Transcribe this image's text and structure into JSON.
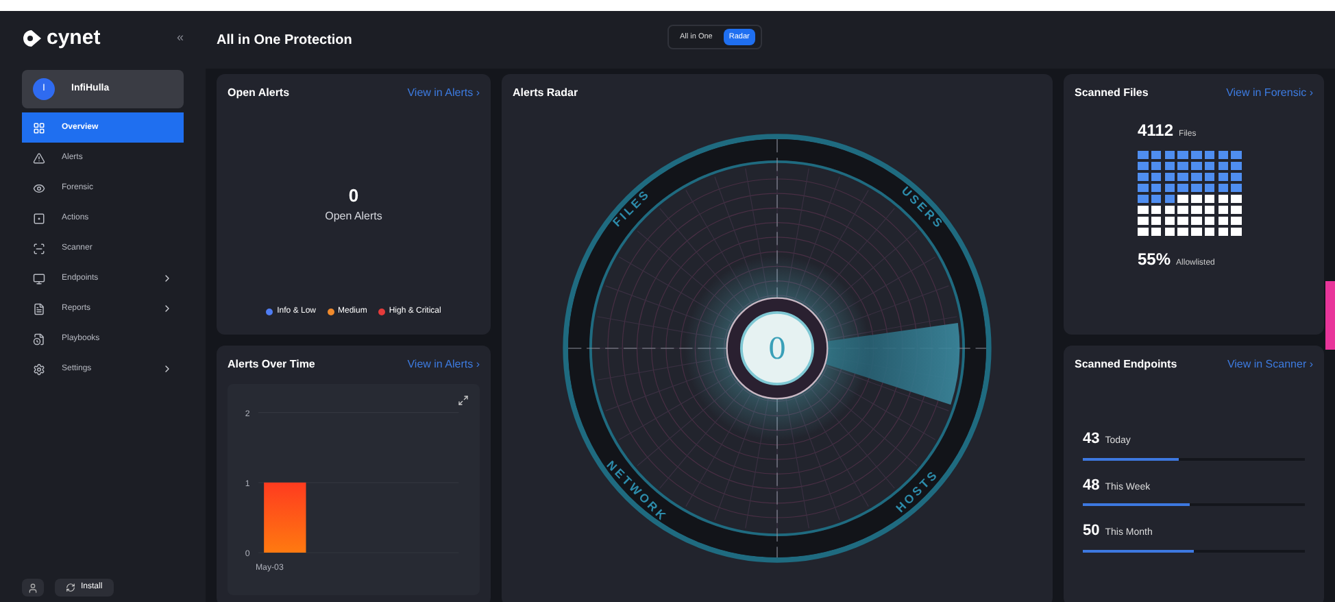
{
  "sidebar": {
    "logo": "cynet",
    "collapse": "«",
    "user": {
      "initial": "I",
      "name": "InfiHulla"
    },
    "items": [
      {
        "label": "Overview",
        "selected": true,
        "submenu": false
      },
      {
        "label": "Alerts",
        "selected": false,
        "submenu": false
      },
      {
        "label": "Forensic",
        "selected": false,
        "submenu": false
      },
      {
        "label": "Actions",
        "selected": false,
        "submenu": false
      },
      {
        "label": "Scanner",
        "selected": false,
        "submenu": false
      },
      {
        "label": "Endpoints",
        "selected": false,
        "submenu": true
      },
      {
        "label": "Reports",
        "selected": false,
        "submenu": true
      },
      {
        "label": "Playbooks",
        "selected": false,
        "submenu": false
      },
      {
        "label": "Settings",
        "selected": false,
        "submenu": true
      }
    ],
    "install_button": "Install"
  },
  "header": {
    "title": "All in One Protection",
    "toggle": [
      {
        "label": "All in One",
        "selected": false
      },
      {
        "label": "Radar",
        "selected": true
      }
    ]
  },
  "open_alerts": {
    "title": "Open Alerts",
    "link": "View in Alerts ›",
    "count": "0",
    "caption": "Open Alerts",
    "legend": [
      {
        "label": "Info & Low",
        "color": "#4f7df3"
      },
      {
        "label": "Medium",
        "color": "#f08a2c"
      },
      {
        "label": "High & Critical",
        "color": "#e53b3b"
      }
    ]
  },
  "alerts_over_time": {
    "title": "Alerts Over Time",
    "link": "View in Alerts ›",
    "chart_data": {
      "type": "bar",
      "categories": [
        "May-03"
      ],
      "series": [
        {
          "color": "#ff3b1f",
          "values": [
            1
          ]
        }
      ],
      "ylim": [
        0,
        2
      ],
      "yticks": [
        0,
        1,
        2
      ]
    }
  },
  "alerts_radar": {
    "title": "Alerts Radar",
    "labels": [
      "FILES",
      "USERS",
      "NETWORK",
      "HOSTS"
    ],
    "count": "0"
  },
  "scanned_files": {
    "title": "Scanned Files",
    "link": "View in Forensic ›",
    "count": "4112",
    "unit": "Files",
    "percent": "55%",
    "percent_label": "Allowlisted"
  },
  "scanned_endpoints": {
    "title": "Scanned Endpoints",
    "link": "View in Scanner ›",
    "rows": [
      {
        "count": "43",
        "label": "Today",
        "level": 0.43
      },
      {
        "count": "48",
        "label": "This Week",
        "level": 0.48
      },
      {
        "count": "50",
        "label": "This Month",
        "level": 0.5
      }
    ]
  }
}
